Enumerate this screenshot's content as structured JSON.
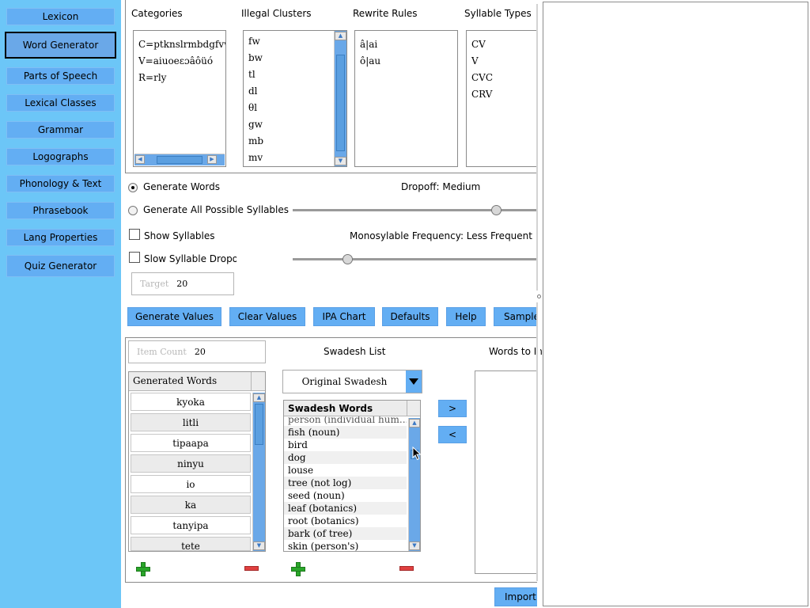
{
  "sidebar": {
    "items": [
      {
        "label": "Lexicon"
      },
      {
        "label": "Word Generator"
      },
      {
        "label": "Parts of Speech"
      },
      {
        "label": "Lexical Classes"
      },
      {
        "label": "Grammar"
      },
      {
        "label": "Logographs"
      },
      {
        "label": "Phonology & Text"
      },
      {
        "label": "Phrasebook"
      },
      {
        "label": "Lang Properties"
      },
      {
        "label": "Quiz Generator"
      }
    ]
  },
  "headers": {
    "categories": "Categories",
    "illegal_clusters": "Illegal Clusters",
    "rewrite_rules": "Rewrite Rules",
    "syllable_types": "Syllable Types"
  },
  "categories": [
    "C=ptknslrmbdgfvw",
    "V=aiuoeɛɔâôüó",
    "R=rly"
  ],
  "illegal_clusters": [
    "fw",
    "bw",
    "tl",
    "dl",
    "θl",
    "gw",
    "mb",
    "mv"
  ],
  "rewrite_rules": [
    "â|ai",
    "ô|au"
  ],
  "syllable_types": [
    "CV",
    "V",
    "CVC",
    "CRV"
  ],
  "options": {
    "generate_words": "Generate Words",
    "generate_all_syllables": "Generate All Possible Syllables",
    "show_syllables": "Show Syllables",
    "slow_syllable_dropoff": "Slow Syllable Dropoff",
    "dropoff_label": "Dropoff: Medium",
    "dropoff_value": 0.82,
    "monosyllable_label": "Monosylable Frequency: Less Frequent",
    "monosyllable_value": 0.22,
    "target_placeholder": "Target",
    "target_value": "20"
  },
  "buttons": {
    "generate_values": "Generate Values",
    "clear_values": "Clear Values",
    "ipa_chart": "IPA Chart",
    "defaults": "Defaults",
    "help": "Help",
    "sample": "Sample"
  },
  "lower": {
    "item_count_placeholder": "Item Count",
    "item_count_value": "20",
    "swadesh_label": "Swadesh List",
    "words_to_import_label": "Words to In",
    "generated_words_header": "Generated Words",
    "generated_words": [
      "kyoka",
      "litli",
      "tipaapa",
      "ninyu",
      "io",
      "ka",
      "tanyipa",
      "tete"
    ],
    "swadesh_dropdown_value": "Original Swadesh",
    "swadesh_words_header": "Swadesh Words",
    "swadesh_words": [
      "person (individual hum...",
      "fish (noun)",
      "bird",
      "dog",
      "louse",
      "tree (not log)",
      "seed (noun)",
      "leaf (botanics)",
      "root (botanics)",
      "bark (of tree)",
      "skin (person's)"
    ],
    "move_right": ">",
    "move_left": "<",
    "import": "Import"
  },
  "colors": {
    "sidebar_bg": "#6cc6f7",
    "button_bg": "#63aef3",
    "add_icon": "#2aa62a",
    "remove_icon": "#e04040"
  }
}
